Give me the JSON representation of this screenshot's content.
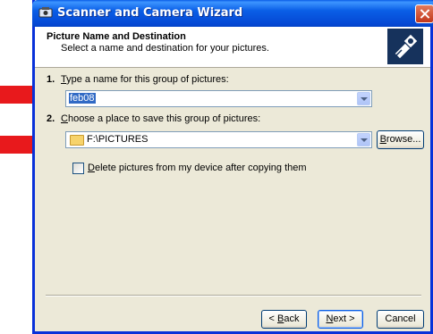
{
  "window": {
    "title": "Scanner and Camera Wizard"
  },
  "header": {
    "title": "Picture Name and Destination",
    "subtitle": "Select a name and destination for your pictures."
  },
  "step1": {
    "number": "1.",
    "label_prefix": "",
    "label_accel": "T",
    "label_rest": "ype a name for this group of pictures:",
    "value": "feb08"
  },
  "step2": {
    "number": "2.",
    "label_accel": "C",
    "label_rest": "hoose a place to save this group of pictures:",
    "value": "F:\\PICTURES",
    "browse_accel": "B",
    "browse_rest": "rowse..."
  },
  "delete_option": {
    "accel": "D",
    "rest": "elete pictures from my device after copying them",
    "checked": false
  },
  "buttons": {
    "back_prefix": "< ",
    "back_accel": "B",
    "back_rest": "ack",
    "next_accel": "N",
    "next_rest": "ext >",
    "cancel": "Cancel"
  },
  "colors": {
    "arrow": "#e8191c",
    "titlebar": "#0a5ee6",
    "selection": "#316ac5"
  }
}
